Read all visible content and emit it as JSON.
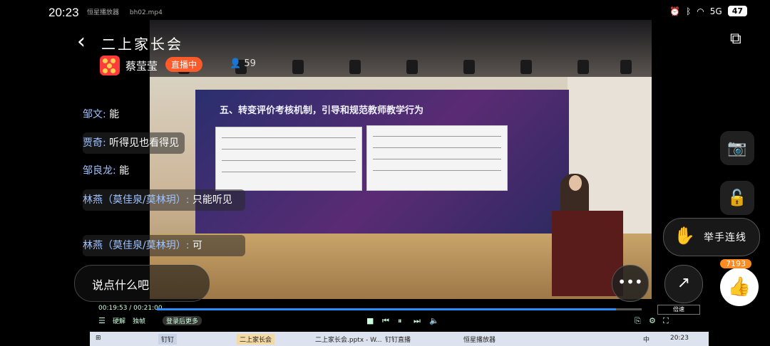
{
  "status_bar": {
    "time": "20:23",
    "network": "5G",
    "battery": "47"
  },
  "player_tab": {
    "app_name": "恒星播放器",
    "file_name": "bh02.mp4"
  },
  "header": {
    "title": "二上家长会",
    "host_name": "蔡莹莹",
    "live_badge": "直播中",
    "viewer_count": "59"
  },
  "slide": {
    "title": "五、转变评价考核机制，引导和规范教师教学行为"
  },
  "chat": [
    {
      "user": "邹文",
      "sep": ":",
      "text": "能"
    },
    {
      "user": "贾奇",
      "sep": ":",
      "text": "听得见也看得见"
    },
    {
      "user": "邹良龙",
      "sep": ":",
      "text": "能"
    },
    {
      "user": "林燕（莫佳泉/莫林玥）",
      "sep": ":",
      "text": "只能听见"
    },
    {
      "user": "林燕（莫佳泉/莫林玥）",
      "sep": ":",
      "text": "可"
    }
  ],
  "comment_input": {
    "placeholder": "说点什么吧"
  },
  "buttons": {
    "raise_hand": "举手连线",
    "like_count": "7193"
  },
  "player": {
    "time": "00:19:53 / 00:21:00",
    "progress": 0.947,
    "speed_label": "倍速",
    "left_labels": [
      "硬解",
      "独帧"
    ],
    "login_label": "登录后更多"
  },
  "taskbar": {
    "items": [
      "钉钉",
      "二上家长会",
      "二上家长会.pptx - W...",
      "钉钉直播",
      "恒星播放器"
    ],
    "time": "20:23",
    "lang": "中"
  },
  "colors": {
    "live_badge": "#ff5a2a",
    "chat_user": "#9fc3ff",
    "like": "#ff8a1f",
    "progress": "#2e8bff"
  }
}
